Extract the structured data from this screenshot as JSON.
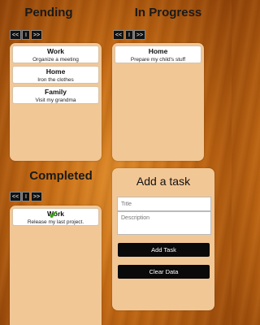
{
  "columns": {
    "pending": {
      "title": "Pending",
      "pager": [
        "<<",
        "I",
        ">>"
      ],
      "cards": [
        {
          "title": "Work",
          "desc": "Organize a meeting"
        },
        {
          "title": "Home",
          "desc": "Iron the clothes"
        },
        {
          "title": "Family",
          "desc": "Visit my grandma"
        }
      ]
    },
    "in_progress": {
      "title": "In Progress",
      "pager": [
        "<<",
        "I",
        ">>"
      ],
      "cards": [
        {
          "title": "Home",
          "desc": "Prepare my child's stuff"
        }
      ]
    },
    "completed": {
      "title": "Completed",
      "pager": [
        "<<",
        "I",
        ">>"
      ],
      "cards": [
        {
          "title": "Work",
          "desc": "Release my last project."
        }
      ]
    }
  },
  "add_task": {
    "title": "Add a task",
    "title_placeholder": "Title",
    "description_placeholder": "Description",
    "add_button": "Add Task",
    "clear_button": "Clear Data"
  },
  "icons": {
    "completed_marker": "check-icon"
  },
  "colors": {
    "panel": "#f2c796",
    "button": "#0a0a0a",
    "check": "#3aa31a"
  }
}
